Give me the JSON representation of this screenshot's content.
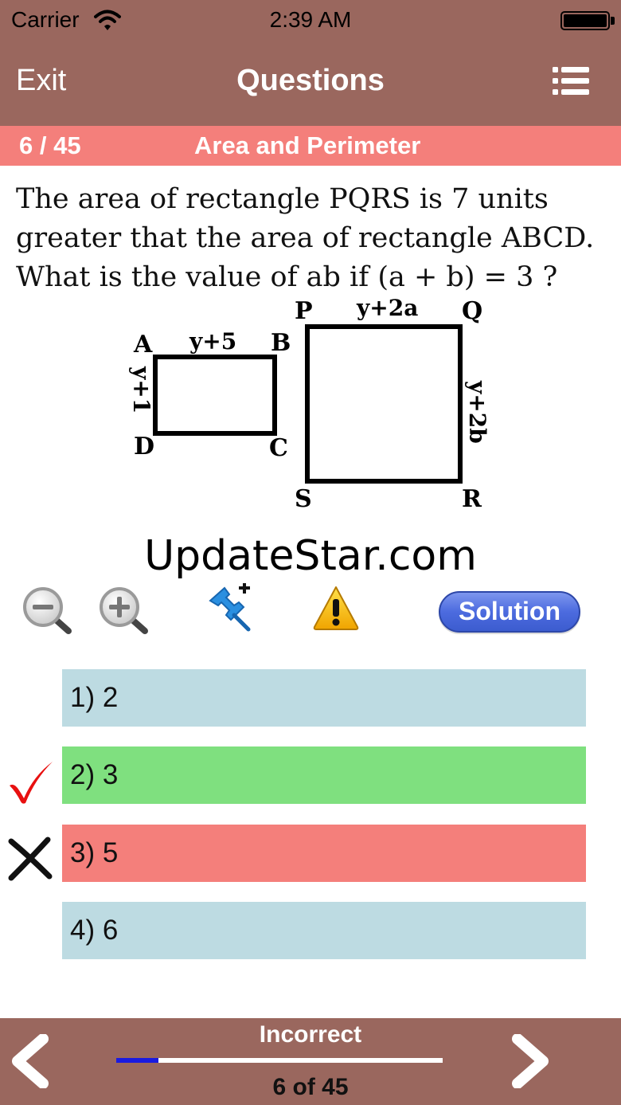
{
  "status_bar": {
    "carrier": "Carrier",
    "time": "2:39 AM"
  },
  "nav": {
    "exit_label": "Exit",
    "title": "Questions",
    "menu_icon": "list-icon"
  },
  "category_bar": {
    "question_number": "6 / 45",
    "title": "Area and Perimeter"
  },
  "question": {
    "text": "The area of rectangle PQRS is 7 units greater that the area of rectangle ABCD. What is the value of ab if (a + b) = 3 ?",
    "diagram": {
      "small_rect": {
        "top_left": "A",
        "top_right": "B",
        "bottom_left": "D",
        "bottom_right": "C",
        "top_side": "y+5",
        "left_side": "y+1"
      },
      "large_rect": {
        "top_left": "P",
        "top_right": "Q",
        "bottom_left": "S",
        "bottom_right": "R",
        "top_side": "y+2a",
        "right_side": "y+2b"
      }
    }
  },
  "watermark": "UpdateStar.com",
  "toolbar": {
    "zoom_out_icon": "zoom-out-icon",
    "zoom_in_icon": "zoom-in-icon",
    "pin_icon": "pin-add-icon",
    "warning_icon": "warning-icon",
    "solution_label": "Solution"
  },
  "answers": [
    {
      "label": "1) 2",
      "state": "neutral",
      "color": "#bddbe2"
    },
    {
      "label": "2) 3",
      "state": "correct",
      "color": "#7fe07f"
    },
    {
      "label": "3) 5",
      "state": "incorrect",
      "color": "#f47f7b"
    },
    {
      "label": "4) 6",
      "state": "neutral",
      "color": "#bddbe2"
    }
  ],
  "footer": {
    "result": "Incorrect",
    "counter": "6 of 45",
    "progress": 0.13,
    "prev_icon": "chevron-left-icon",
    "next_icon": "chevron-right-icon"
  },
  "colors": {
    "header": "#9a675e",
    "category_bar": "#f47f7b",
    "progress_fill": "#1a1ae0"
  }
}
